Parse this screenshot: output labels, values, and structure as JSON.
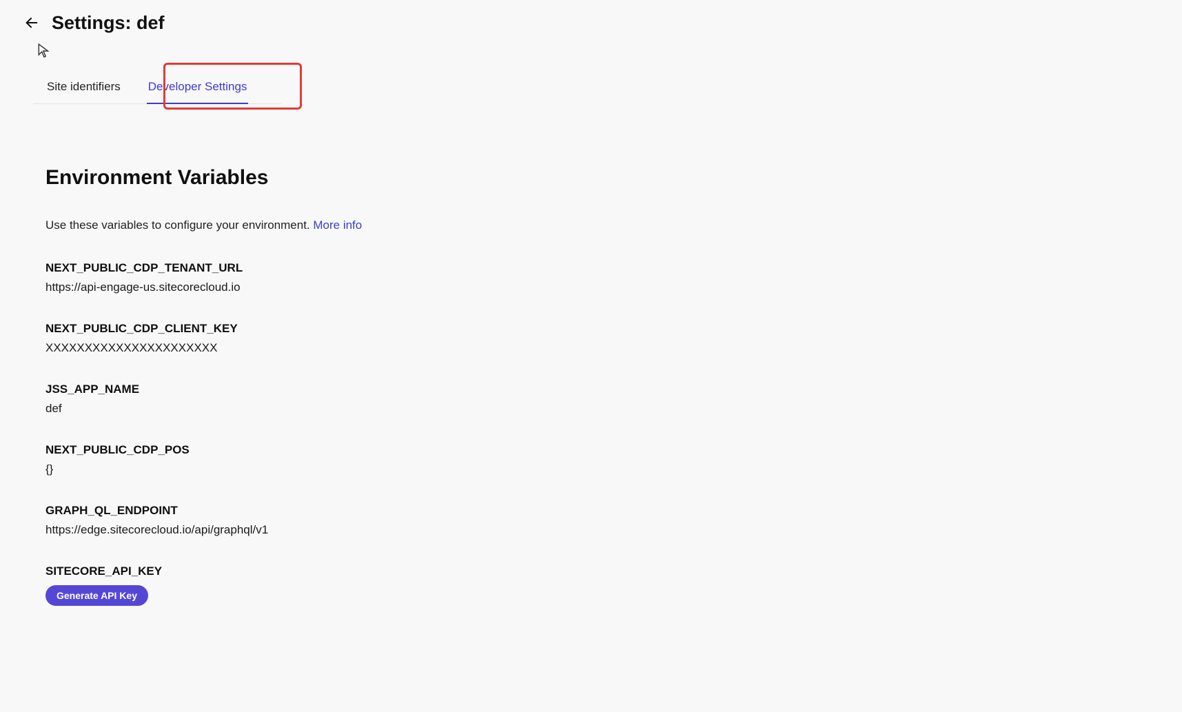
{
  "header": {
    "title": "Settings: def"
  },
  "tabs": [
    {
      "label": "Site identifiers",
      "active": false
    },
    {
      "label": "Developer Settings",
      "active": true
    }
  ],
  "section": {
    "heading": "Environment Variables",
    "description": "Use these variables to configure your environment. ",
    "more_info": "More info"
  },
  "env_vars": [
    {
      "name": "NEXT_PUBLIC_CDP_TENANT_URL",
      "value": "https://api-engage-us.sitecorecloud.io"
    },
    {
      "name": "NEXT_PUBLIC_CDP_CLIENT_KEY",
      "value": "XXXXXXXXXXXXXXXXXXXXXX"
    },
    {
      "name": "JSS_APP_NAME",
      "value": "def"
    },
    {
      "name": "NEXT_PUBLIC_CDP_POS",
      "value": "{}"
    },
    {
      "name": "GRAPH_QL_ENDPOINT",
      "value": "https://edge.sitecorecloud.io/api/graphql/v1"
    },
    {
      "name": "SITECORE_API_KEY",
      "value": null
    }
  ],
  "buttons": {
    "generate_api_key": "Generate API Key"
  }
}
